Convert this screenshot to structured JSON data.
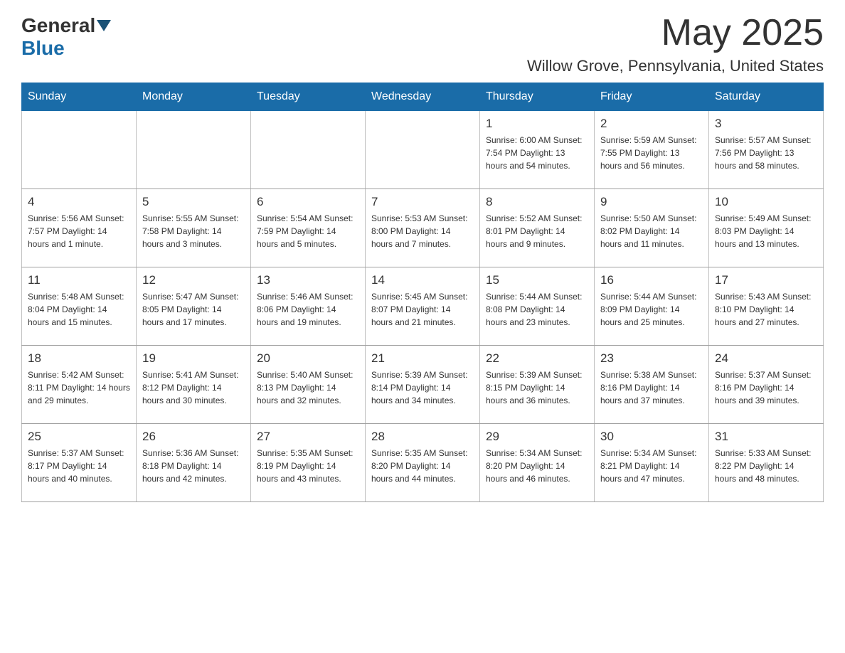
{
  "header": {
    "logo_general": "General",
    "logo_blue": "Blue",
    "month_title": "May 2025",
    "location": "Willow Grove, Pennsylvania, United States"
  },
  "days_of_week": [
    "Sunday",
    "Monday",
    "Tuesday",
    "Wednesday",
    "Thursday",
    "Friday",
    "Saturday"
  ],
  "weeks": [
    [
      {
        "day": "",
        "info": ""
      },
      {
        "day": "",
        "info": ""
      },
      {
        "day": "",
        "info": ""
      },
      {
        "day": "",
        "info": ""
      },
      {
        "day": "1",
        "info": "Sunrise: 6:00 AM\nSunset: 7:54 PM\nDaylight: 13 hours\nand 54 minutes."
      },
      {
        "day": "2",
        "info": "Sunrise: 5:59 AM\nSunset: 7:55 PM\nDaylight: 13 hours\nand 56 minutes."
      },
      {
        "day": "3",
        "info": "Sunrise: 5:57 AM\nSunset: 7:56 PM\nDaylight: 13 hours\nand 58 minutes."
      }
    ],
    [
      {
        "day": "4",
        "info": "Sunrise: 5:56 AM\nSunset: 7:57 PM\nDaylight: 14 hours\nand 1 minute."
      },
      {
        "day": "5",
        "info": "Sunrise: 5:55 AM\nSunset: 7:58 PM\nDaylight: 14 hours\nand 3 minutes."
      },
      {
        "day": "6",
        "info": "Sunrise: 5:54 AM\nSunset: 7:59 PM\nDaylight: 14 hours\nand 5 minutes."
      },
      {
        "day": "7",
        "info": "Sunrise: 5:53 AM\nSunset: 8:00 PM\nDaylight: 14 hours\nand 7 minutes."
      },
      {
        "day": "8",
        "info": "Sunrise: 5:52 AM\nSunset: 8:01 PM\nDaylight: 14 hours\nand 9 minutes."
      },
      {
        "day": "9",
        "info": "Sunrise: 5:50 AM\nSunset: 8:02 PM\nDaylight: 14 hours\nand 11 minutes."
      },
      {
        "day": "10",
        "info": "Sunrise: 5:49 AM\nSunset: 8:03 PM\nDaylight: 14 hours\nand 13 minutes."
      }
    ],
    [
      {
        "day": "11",
        "info": "Sunrise: 5:48 AM\nSunset: 8:04 PM\nDaylight: 14 hours\nand 15 minutes."
      },
      {
        "day": "12",
        "info": "Sunrise: 5:47 AM\nSunset: 8:05 PM\nDaylight: 14 hours\nand 17 minutes."
      },
      {
        "day": "13",
        "info": "Sunrise: 5:46 AM\nSunset: 8:06 PM\nDaylight: 14 hours\nand 19 minutes."
      },
      {
        "day": "14",
        "info": "Sunrise: 5:45 AM\nSunset: 8:07 PM\nDaylight: 14 hours\nand 21 minutes."
      },
      {
        "day": "15",
        "info": "Sunrise: 5:44 AM\nSunset: 8:08 PM\nDaylight: 14 hours\nand 23 minutes."
      },
      {
        "day": "16",
        "info": "Sunrise: 5:44 AM\nSunset: 8:09 PM\nDaylight: 14 hours\nand 25 minutes."
      },
      {
        "day": "17",
        "info": "Sunrise: 5:43 AM\nSunset: 8:10 PM\nDaylight: 14 hours\nand 27 minutes."
      }
    ],
    [
      {
        "day": "18",
        "info": "Sunrise: 5:42 AM\nSunset: 8:11 PM\nDaylight: 14 hours\nand 29 minutes."
      },
      {
        "day": "19",
        "info": "Sunrise: 5:41 AM\nSunset: 8:12 PM\nDaylight: 14 hours\nand 30 minutes."
      },
      {
        "day": "20",
        "info": "Sunrise: 5:40 AM\nSunset: 8:13 PM\nDaylight: 14 hours\nand 32 minutes."
      },
      {
        "day": "21",
        "info": "Sunrise: 5:39 AM\nSunset: 8:14 PM\nDaylight: 14 hours\nand 34 minutes."
      },
      {
        "day": "22",
        "info": "Sunrise: 5:39 AM\nSunset: 8:15 PM\nDaylight: 14 hours\nand 36 minutes."
      },
      {
        "day": "23",
        "info": "Sunrise: 5:38 AM\nSunset: 8:16 PM\nDaylight: 14 hours\nand 37 minutes."
      },
      {
        "day": "24",
        "info": "Sunrise: 5:37 AM\nSunset: 8:16 PM\nDaylight: 14 hours\nand 39 minutes."
      }
    ],
    [
      {
        "day": "25",
        "info": "Sunrise: 5:37 AM\nSunset: 8:17 PM\nDaylight: 14 hours\nand 40 minutes."
      },
      {
        "day": "26",
        "info": "Sunrise: 5:36 AM\nSunset: 8:18 PM\nDaylight: 14 hours\nand 42 minutes."
      },
      {
        "day": "27",
        "info": "Sunrise: 5:35 AM\nSunset: 8:19 PM\nDaylight: 14 hours\nand 43 minutes."
      },
      {
        "day": "28",
        "info": "Sunrise: 5:35 AM\nSunset: 8:20 PM\nDaylight: 14 hours\nand 44 minutes."
      },
      {
        "day": "29",
        "info": "Sunrise: 5:34 AM\nSunset: 8:20 PM\nDaylight: 14 hours\nand 46 minutes."
      },
      {
        "day": "30",
        "info": "Sunrise: 5:34 AM\nSunset: 8:21 PM\nDaylight: 14 hours\nand 47 minutes."
      },
      {
        "day": "31",
        "info": "Sunrise: 5:33 AM\nSunset: 8:22 PM\nDaylight: 14 hours\nand 48 minutes."
      }
    ]
  ]
}
